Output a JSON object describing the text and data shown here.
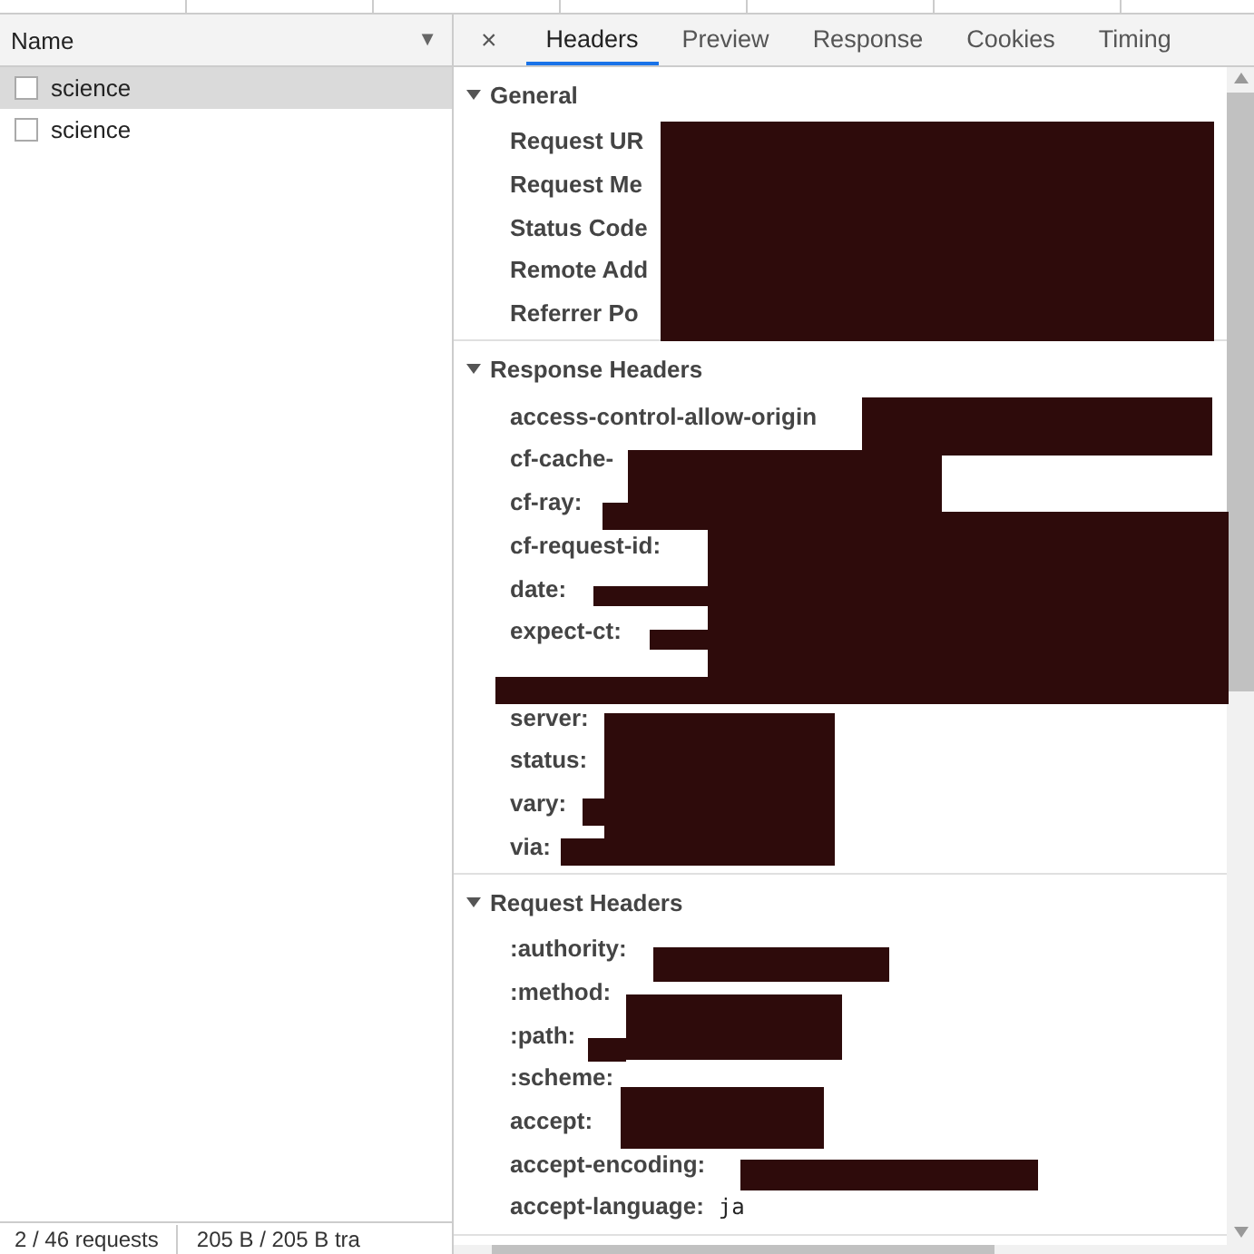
{
  "request_list": {
    "column": "Name",
    "sort_icon": "▼",
    "rows": [
      {
        "name": "science",
        "selected": true
      },
      {
        "name": "science",
        "selected": false
      }
    ]
  },
  "status_bar": [
    "2 / 46 requests",
    "205 B / 205 B tra"
  ],
  "detail": {
    "close": "×",
    "tabs": [
      {
        "label": "Headers",
        "selected": true
      },
      {
        "label": "Preview",
        "selected": false
      },
      {
        "label": "Response",
        "selected": false
      },
      {
        "label": "Cookies",
        "selected": false
      },
      {
        "label": "Timing",
        "selected": false
      }
    ],
    "sections": [
      {
        "title": "General",
        "expanded": true,
        "rows": [
          {
            "kind": "header",
            "key": "Request UR"
          },
          {
            "kind": "header",
            "key": "Request Me"
          },
          {
            "kind": "header",
            "key": "Status Code"
          },
          {
            "kind": "header",
            "key": "Remote Add"
          },
          {
            "kind": "header",
            "key": "Referrer Po"
          }
        ]
      },
      {
        "title": "Response Headers",
        "expanded": true,
        "rows": [
          {
            "kind": "header",
            "key": "access-control-allow-origin"
          },
          {
            "kind": "header",
            "key": "cf-cache-"
          },
          {
            "kind": "header",
            "key": "cf-ray:"
          },
          {
            "kind": "header",
            "key": "cf-request-id:"
          },
          {
            "kind": "header",
            "key": "date:"
          },
          {
            "kind": "header",
            "key": "expect-ct:"
          },
          {
            "kind": "covered"
          },
          {
            "kind": "header",
            "key": "server:"
          },
          {
            "kind": "header",
            "key": "status:"
          },
          {
            "kind": "header",
            "key": "vary:"
          },
          {
            "kind": "header",
            "key": "via:"
          }
        ]
      },
      {
        "title": "Request Headers",
        "expanded": true,
        "rows": [
          {
            "kind": "header",
            "key": ":authority:"
          },
          {
            "kind": "header",
            "key": ":method:"
          },
          {
            "kind": "header",
            "key": ":path:"
          },
          {
            "kind": "header",
            "key": ":scheme:"
          },
          {
            "kind": "header",
            "key": "accept:"
          },
          {
            "kind": "header",
            "key": "accept-encoding:"
          },
          {
            "kind": "header",
            "key": "accept-language:",
            "value": "ja"
          }
        ]
      }
    ]
  }
}
